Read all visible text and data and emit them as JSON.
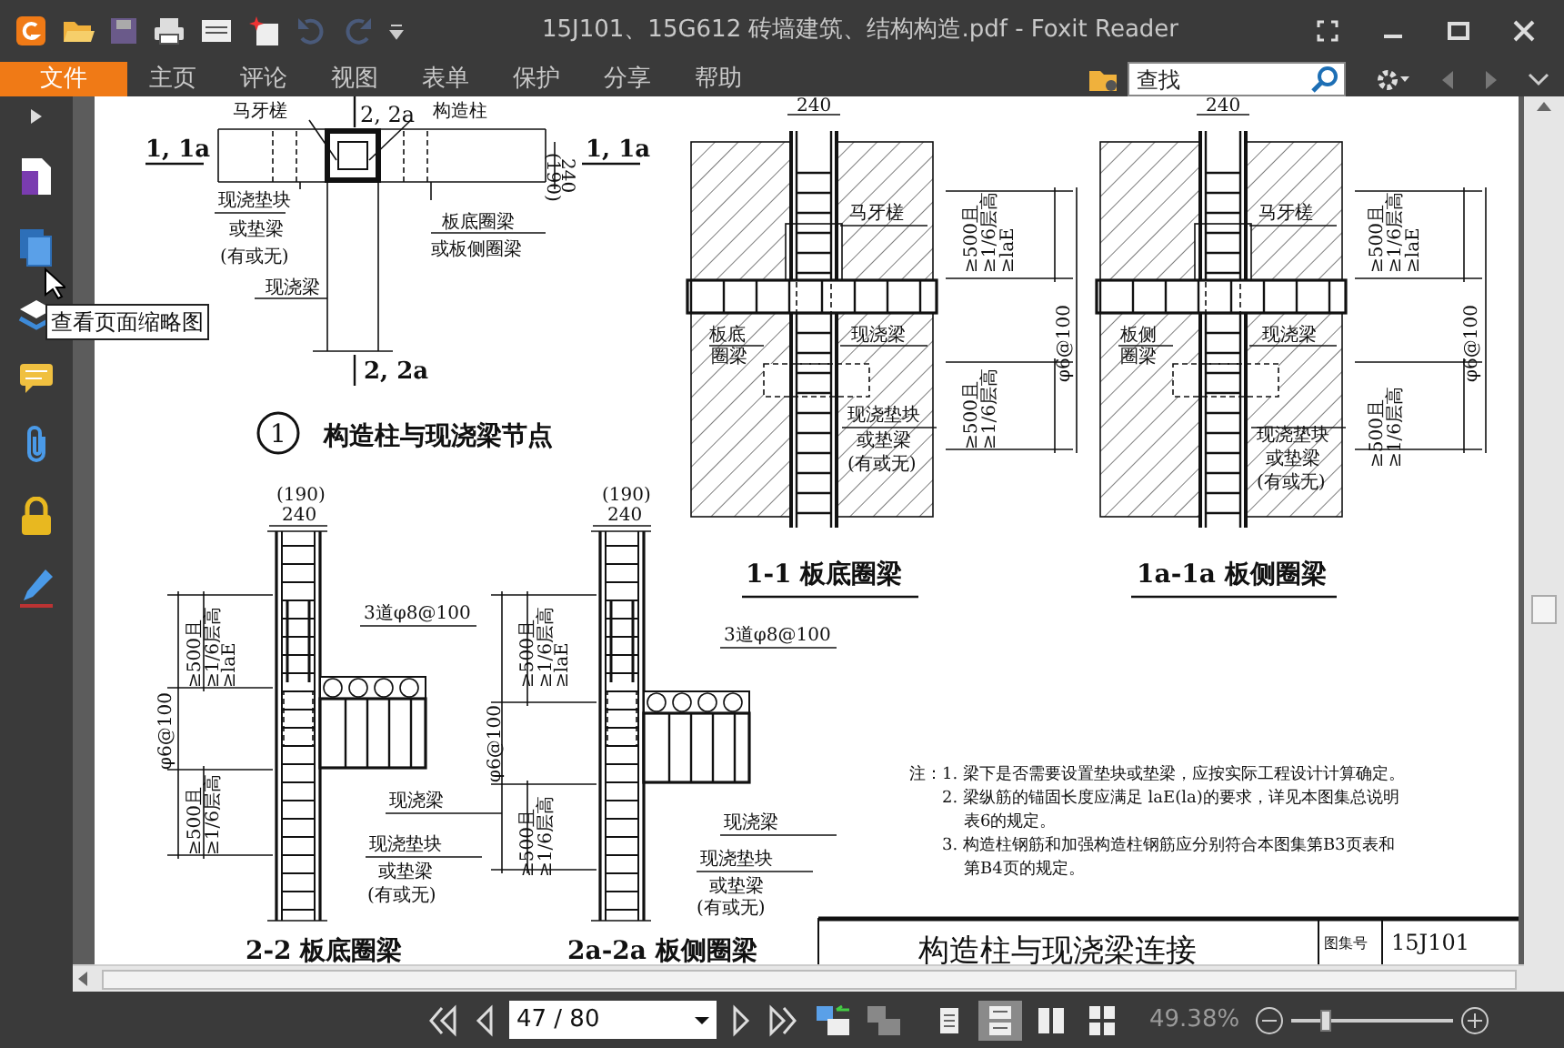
{
  "window": {
    "title": "15J101、15G612 砖墙建筑、结构构造.pdf - Foxit Reader"
  },
  "menu": [
    {
      "label": "文件",
      "selected": true
    },
    {
      "label": "主页",
      "selected": false
    },
    {
      "label": "评论",
      "selected": false
    },
    {
      "label": "视图",
      "selected": false
    },
    {
      "label": "表单",
      "selected": false
    },
    {
      "label": "保护",
      "selected": false
    },
    {
      "label": "分享",
      "selected": false
    },
    {
      "label": "帮助",
      "selected": false
    }
  ],
  "search": {
    "placeholder": "查找"
  },
  "tooltip": "查看页面缩略图",
  "document": {
    "plan": {
      "labels": [
        "马牙槎",
        "2, 2a",
        "构造柱",
        "1, 1a",
        "1, 1a",
        "(190)",
        "240",
        "现浇垫块",
        "或垫梁",
        "(有或无)",
        "板底圈梁",
        "或板侧圈梁",
        "现浇梁",
        "2, 2a"
      ],
      "caption_number": "1",
      "caption": "构造柱与现浇梁节点"
    },
    "sections": [
      {
        "kind": "slab-edge",
        "labels": [
          "240",
          "马牙槎",
          "≥500且",
          "≥1/6层高",
          "≥laE",
          "φ6@100",
          "板底",
          "圈梁",
          "现浇梁",
          "≥500且",
          "≥1/6层高",
          "现浇垫块",
          "或垫梁",
          "(有或无)"
        ],
        "caption": "1-1  板底圈梁"
      },
      {
        "kind": "slab-edge",
        "labels": [
          "240",
          "马牙槎",
          "≥500且",
          "≥1/6层高",
          "≥laE",
          "φ6@100",
          "板侧",
          "圈梁",
          "现浇梁",
          "≥500且",
          "≥1/6层高",
          "现浇垫块",
          "或垫梁",
          "(有或无)"
        ],
        "caption": "1a-1a  板侧圈梁"
      },
      {
        "kind": "beam",
        "labels": [
          "(190)",
          "240",
          "≥500且",
          "≥1/6层高",
          "≥laE",
          "φ6@100",
          "≥500且",
          "≥1/6层高",
          "3道φ8@100",
          "现浇梁",
          "现浇垫块",
          "或垫梁",
          "(有或无)"
        ],
        "caption": "2-2  板底圈梁"
      },
      {
        "kind": "beam",
        "labels": [
          "(190)",
          "240",
          "≥500且",
          "≥1/6层高",
          "≥laE",
          "φ6@100",
          "≥500且",
          "≥1/6层高",
          "3道φ8@100",
          "现浇梁",
          "现浇垫块",
          "或垫梁",
          "(有或无)"
        ],
        "caption": "2a-2a  板侧圈梁"
      }
    ],
    "notes": [
      "注：1. 梁下是否需要设置垫块或垫梁，应按实际工程设计计算确定。",
      "2. 梁纵筋的锚固长度应满足 laE(la)的要求，详见本图集总说明",
      "表6的规定。",
      "3. 构造柱钢筋和加强构造柱钢筋应分别符合本图集第B3页表和",
      "第B4页的规定。"
    ],
    "title_block": {
      "title": "构造柱与现浇梁连接",
      "label": "图集号",
      "number": "15J101"
    }
  },
  "status_bar": {
    "page": "47 / 80",
    "zoom": "49.38%",
    "zoom_slider": {
      "level": 0.2
    },
    "view_modes": [
      {
        "kind": "single",
        "selected": false
      },
      {
        "kind": "continuous",
        "selected": true
      },
      {
        "kind": "facing",
        "selected": false
      },
      {
        "kind": "continuous-facing",
        "selected": false
      }
    ]
  }
}
